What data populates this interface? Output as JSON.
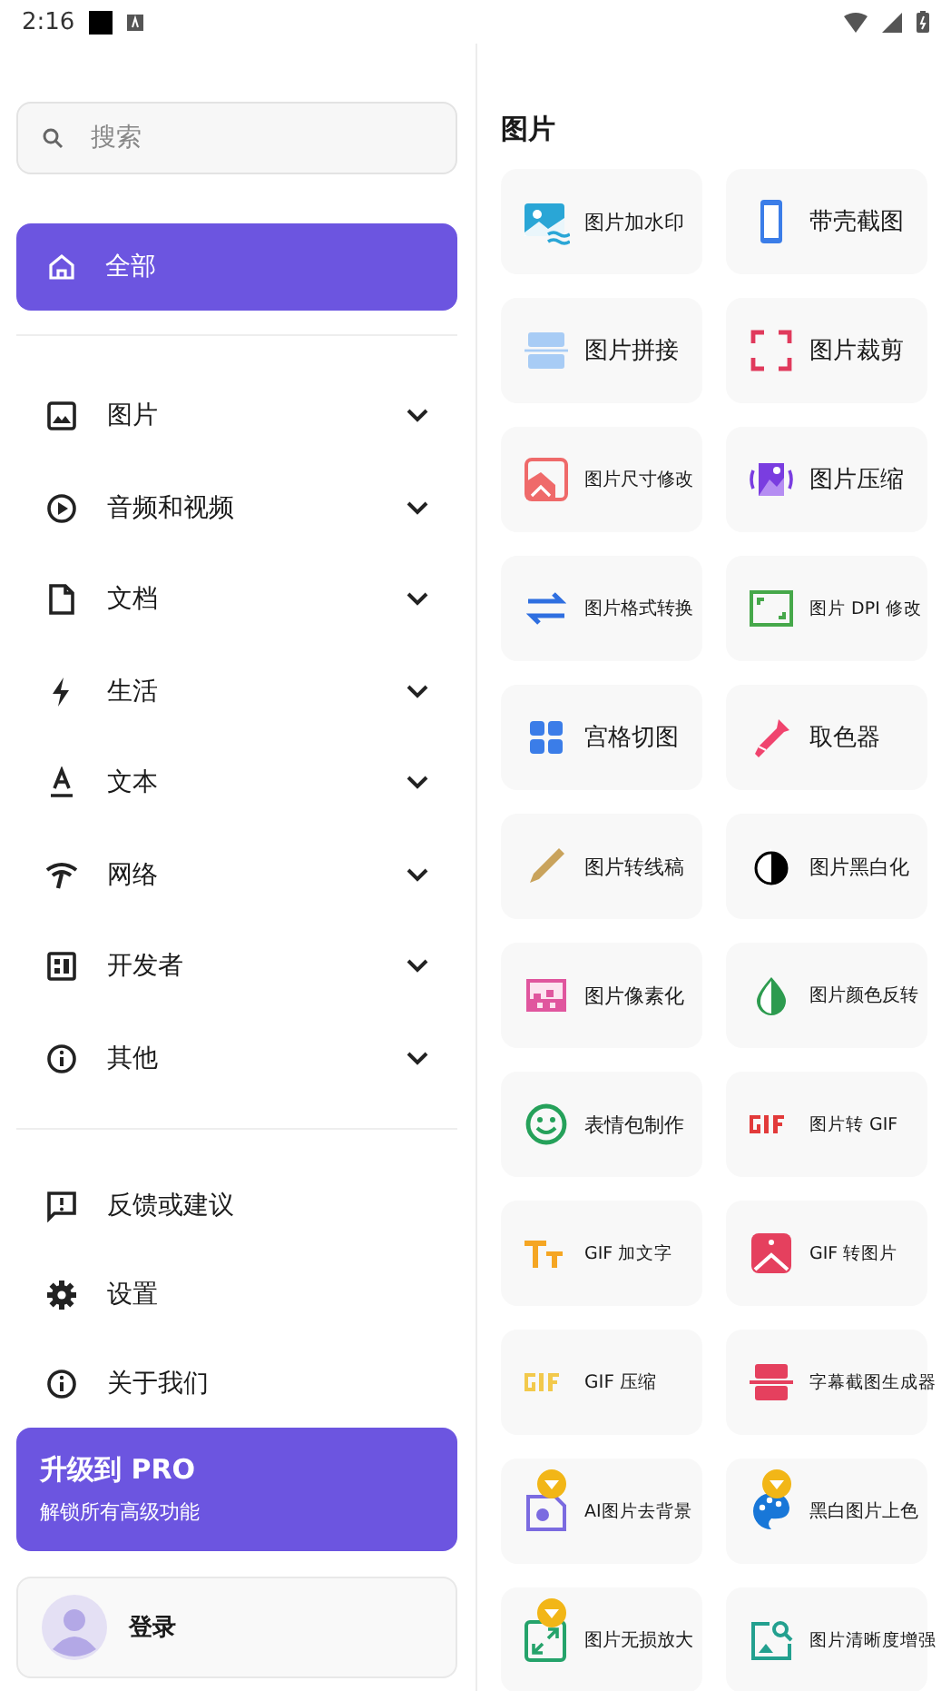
{
  "status_bar": {
    "time": "2:16"
  },
  "search": {
    "placeholder": "搜索"
  },
  "all_item": {
    "label": "全部",
    "selected": true
  },
  "categories": [
    {
      "label": "图片",
      "expanded": false
    },
    {
      "label": "音频和视频",
      "expanded": false
    },
    {
      "label": "文档",
      "expanded": false
    },
    {
      "label": "生活",
      "expanded": false
    },
    {
      "label": "文本",
      "expanded": false
    },
    {
      "label": "网络",
      "expanded": false
    },
    {
      "label": "开发者",
      "expanded": false
    },
    {
      "label": "其他",
      "expanded": false
    }
  ],
  "links": [
    {
      "label": "反馈或建议"
    },
    {
      "label": "设置"
    },
    {
      "label": "关于我们"
    }
  ],
  "pro_card": {
    "title": "升级到 PRO",
    "subtitle": "解锁所有高级功能"
  },
  "login": {
    "label": "登录"
  },
  "section_title": "图片",
  "tools": [
    {
      "label": "图片加水印",
      "vip": false
    },
    {
      "label": "带壳截图",
      "vip": false
    },
    {
      "label": "图片拼接",
      "vip": false
    },
    {
      "label": "图片裁剪",
      "vip": false
    },
    {
      "label": "图片尺寸修改",
      "vip": false
    },
    {
      "label": "图片压缩",
      "vip": false
    },
    {
      "label": "图片格式转换",
      "vip": false
    },
    {
      "label": "图片 DPI 修改",
      "vip": false
    },
    {
      "label": "宫格切图",
      "vip": false
    },
    {
      "label": "取色器",
      "vip": false
    },
    {
      "label": "图片转线稿",
      "vip": false
    },
    {
      "label": "图片黑白化",
      "vip": false
    },
    {
      "label": "图片像素化",
      "vip": false
    },
    {
      "label": "图片颜色反转",
      "vip": false
    },
    {
      "label": "表情包制作",
      "vip": false
    },
    {
      "label": "图片转 GIF",
      "vip": false
    },
    {
      "label": "GIF 加文字",
      "vip": false
    },
    {
      "label": "GIF 转图片",
      "vip": false
    },
    {
      "label": "GIF 压缩",
      "vip": false
    },
    {
      "label": "字幕截图生成器",
      "vip": false
    },
    {
      "label": "AI图片去背景",
      "vip": true
    },
    {
      "label": "黑白图片上色",
      "vip": true
    },
    {
      "label": "图片无损放大",
      "vip": true
    },
    {
      "label": "图片清晰度增强",
      "vip": false
    }
  ]
}
